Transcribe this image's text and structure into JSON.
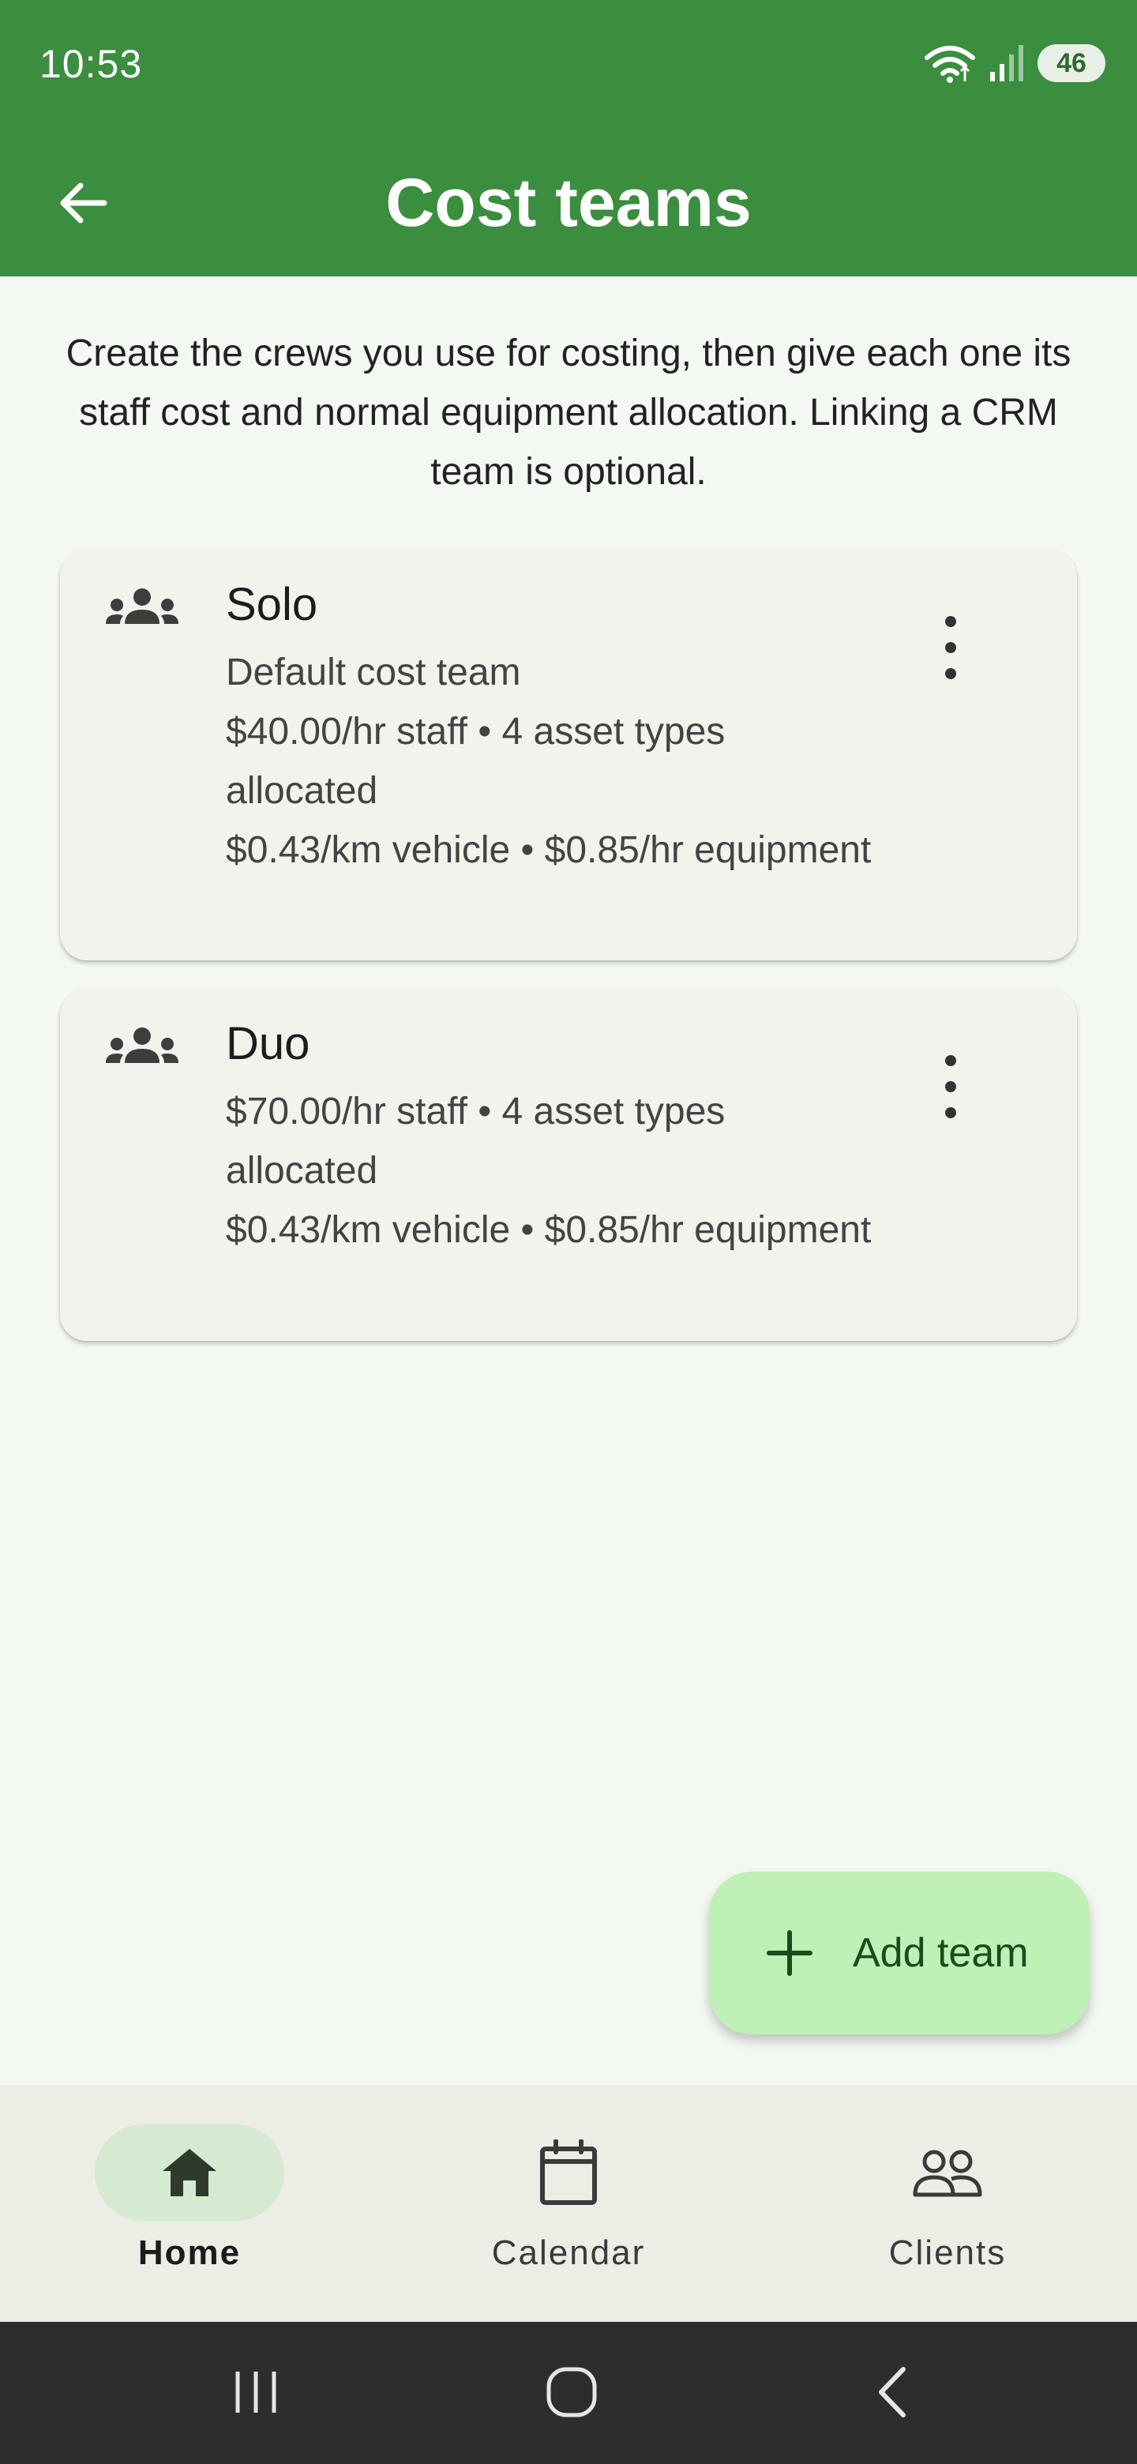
{
  "status": {
    "time": "10:53",
    "battery": "46"
  },
  "appbar": {
    "title": "Cost teams"
  },
  "intro": "Create the crews you use for costing, then give each one its staff cost and normal equipment allocation. Linking a CRM team is optional.",
  "teams": [
    {
      "name": "Solo",
      "lines": [
        "Default cost team",
        "$40.00/hr staff • 4 asset types allocated",
        "$0.43/km vehicle • $0.85/hr equipment"
      ]
    },
    {
      "name": "Duo",
      "lines": [
        "$70.00/hr staff • 4 asset types allocated",
        "$0.43/km vehicle • $0.85/hr equipment"
      ]
    }
  ],
  "fab": {
    "label": "Add team",
    "icon": "plus-icon"
  },
  "nav": [
    {
      "label": "Home",
      "icon": "home-icon",
      "active": true
    },
    {
      "label": "Calendar",
      "icon": "calendar-icon",
      "active": false
    },
    {
      "label": "Clients",
      "icon": "people-icon",
      "active": false
    }
  ],
  "colors": {
    "primary": "#3a8e3e",
    "fab": "#bff0b6",
    "card": "#f2f3ec",
    "nav_active_pill": "#d5ead0"
  }
}
